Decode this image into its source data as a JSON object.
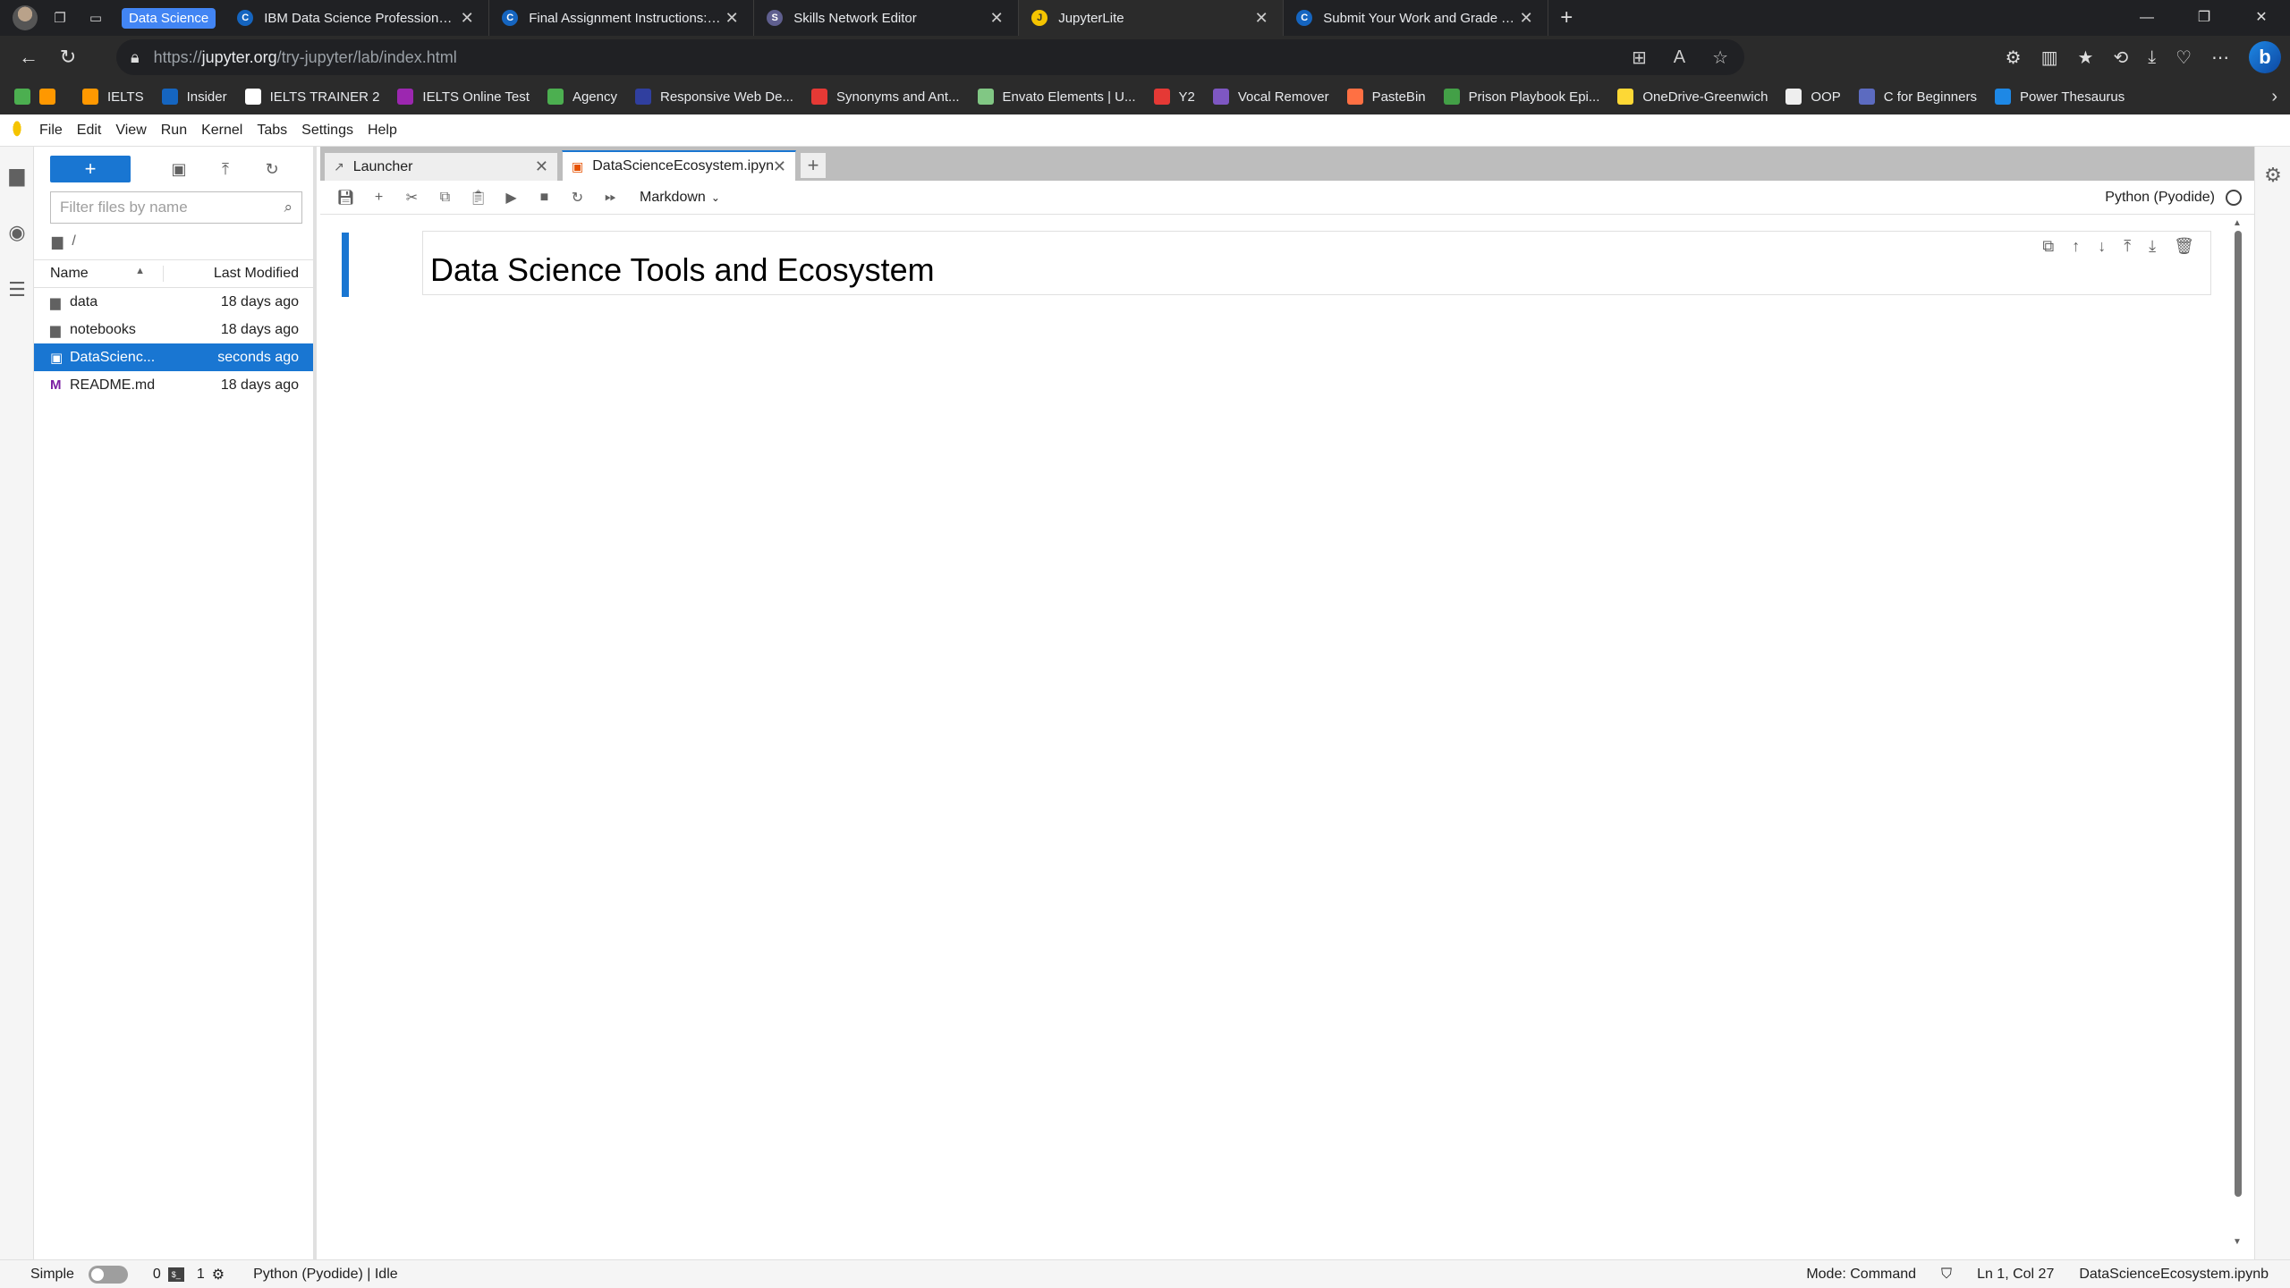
{
  "browser": {
    "tab_group": "Data Science",
    "tabs": [
      {
        "title": "IBM Data Science Professional Ce",
        "favicon": "C",
        "color": "#1565c0"
      },
      {
        "title": "Final Assignment Instructions: Cr",
        "favicon": "C",
        "color": "#1565c0"
      },
      {
        "title": "Skills Network Editor",
        "favicon": "S",
        "color": "#5f5f8f"
      },
      {
        "title": "JupyterLite",
        "favicon": "J",
        "color": "#f5c400"
      },
      {
        "title": "Submit Your Work and Grade You",
        "favicon": "C",
        "color": "#1565c0"
      }
    ],
    "url_prefix": "https://",
    "url_host": "jupyter.org",
    "url_path": "/try-jupyter/lab/index.html",
    "bookmarks": [
      {
        "label": "IELTS",
        "color": "#ff9800"
      },
      {
        "label": "Insider",
        "color": "#1565c0"
      },
      {
        "label": "IELTS TRAINER 2",
        "color": "#ffffff"
      },
      {
        "label": "IELTS Online Test",
        "color": "#9c27b0"
      },
      {
        "label": "Agency",
        "color": "#4caf50"
      },
      {
        "label": "Responsive Web De...",
        "color": "#303f9f"
      },
      {
        "label": "Synonyms and Ant...",
        "color": "#e53935"
      },
      {
        "label": "Envato Elements | U...",
        "color": "#81c784"
      },
      {
        "label": "Y2",
        "color": "#e53935"
      },
      {
        "label": "Vocal Remover",
        "color": "#7e57c2"
      },
      {
        "label": "PasteBin",
        "color": "#ff7043"
      },
      {
        "label": "Prison Playbook Epi...",
        "color": "#43a047"
      },
      {
        "label": "OneDrive-Greenwich",
        "color": "#fdd835"
      },
      {
        "label": "OOP",
        "color": "#eeeeee"
      },
      {
        "label": "C for Beginners",
        "color": "#5c6bc0"
      },
      {
        "label": "Power Thesaurus",
        "color": "#1e88e5"
      }
    ]
  },
  "jupyter": {
    "menu": [
      "File",
      "Edit",
      "View",
      "Run",
      "Kernel",
      "Tabs",
      "Settings",
      "Help"
    ],
    "filebrowser": {
      "filter_placeholder": "Filter files by name",
      "breadcrumb": "/",
      "col_name": "Name",
      "col_modified": "Last Modified",
      "files": [
        {
          "name": "data",
          "modified": "18 days ago",
          "icon": "folder-icon"
        },
        {
          "name": "notebooks",
          "modified": "18 days ago",
          "icon": "folder-icon"
        },
        {
          "name": "DataScienc...",
          "modified": "seconds ago",
          "icon": "notebook-icon",
          "selected": true
        },
        {
          "name": "README.md",
          "modified": "18 days ago",
          "icon": "markdown-icon"
        }
      ]
    },
    "doc_tabs": [
      {
        "label": "Launcher"
      },
      {
        "label": "DataScienceEcosystem.ipynb",
        "active": true
      }
    ],
    "cell_type": "Markdown",
    "kernel_name": "Python (Pyodide)",
    "cell_heading": "Data Science Tools and Ecosystem",
    "status": {
      "mode_label": "Simple",
      "count_a": "0",
      "count_b": "1",
      "kernel_status": "Python (Pyodide) | Idle",
      "mode": "Mode: Command",
      "position": "Ln 1, Col 27",
      "file": "DataScienceEcosystem.ipynb"
    }
  }
}
